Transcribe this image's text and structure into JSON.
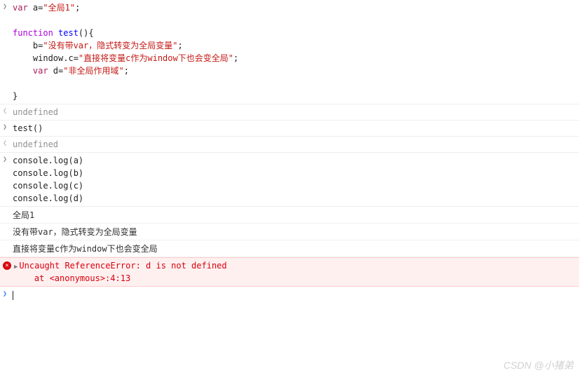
{
  "block1": {
    "line1_pre": "var",
    "line1_var": " a",
    "line1_eq": "=",
    "line1_str": "\"全局1\"",
    "line1_semi": ";",
    "line3_fn": "function",
    "line3_name": " test",
    "line3_rest": "(){",
    "line4_b": "    b=",
    "line4_str": "\"没有带var，隐式转变为全局变量\"",
    "line4_semi": ";",
    "line5_pre": "    window.c=",
    "line5_str": "\"直接将变量c作为window下也会变全局\"",
    "line5_semi": ";",
    "line6_var": "    var",
    "line6_d": " d=",
    "line6_str": "\"非全局作用域\"",
    "line6_semi": ";",
    "line8_close": "}"
  },
  "out1": "undefined",
  "block2": {
    "call": "test()"
  },
  "out2": "undefined",
  "block3": {
    "l1": "console.log(a)",
    "l2": "console.log(b)",
    "l3": "console.log(c)",
    "l4": "console.log(d)"
  },
  "logs": {
    "r1": "全局1",
    "r2": "没有带var，隐式转变为全局变量",
    "r3": "直接将变量c作为window下也会变全局"
  },
  "error": {
    "line1": "Uncaught ReferenceError: d is not defined",
    "line2": "    at <anonymous>:4:13"
  },
  "watermark": "CSDN @小猪弟",
  "gutters": {
    "input": "❯",
    "output": "❮"
  }
}
